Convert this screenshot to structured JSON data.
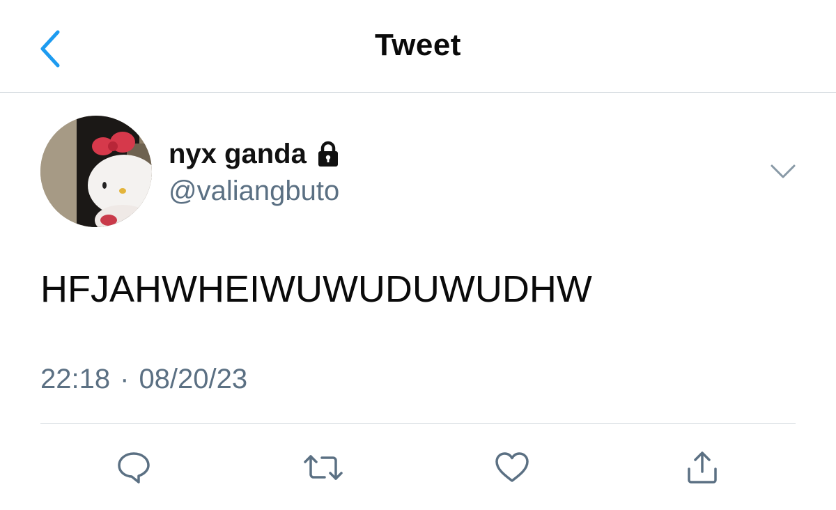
{
  "header": {
    "title": "Tweet",
    "back_icon": "chevron-left-icon"
  },
  "author": {
    "display_name": "nyx ganda",
    "handle": "@valiangbuto",
    "protected_icon": "lock-icon",
    "avatar_description": "hello-kitty-plush-avatar"
  },
  "tweet": {
    "text": "HFJAHWHEIWUWUDUWUDHW",
    "time": "22:18",
    "separator": "·",
    "date": "08/20/23"
  },
  "actions": [
    {
      "icon": "reply-icon"
    },
    {
      "icon": "retweet-icon"
    },
    {
      "icon": "like-icon"
    },
    {
      "icon": "share-icon"
    }
  ],
  "colors": {
    "accent": "#1da1f2",
    "secondary_text": "#5b7083",
    "divider": "#cfd6dc"
  }
}
